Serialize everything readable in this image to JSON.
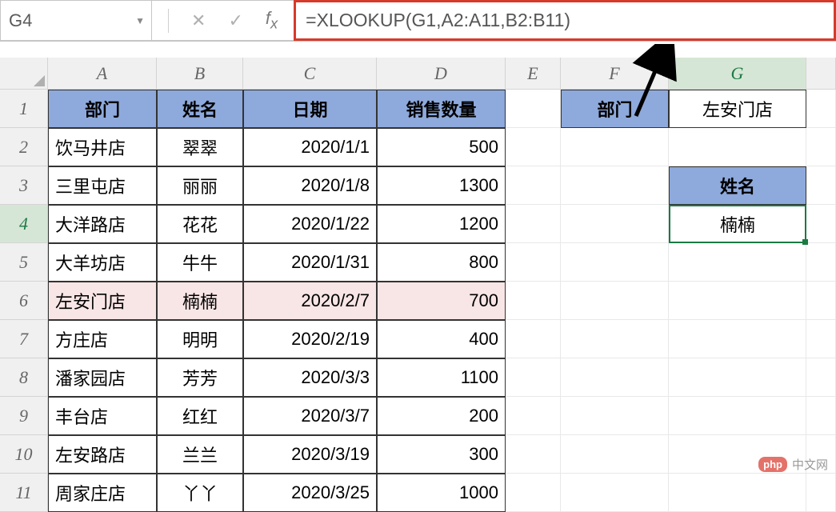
{
  "nameBox": "G4",
  "formula": "=XLOOKUP(G1,A2:A11,B2:B11)",
  "columns": [
    "A",
    "B",
    "C",
    "D",
    "E",
    "F",
    "G"
  ],
  "rows": [
    "1",
    "2",
    "3",
    "4",
    "5",
    "6",
    "7",
    "8",
    "9",
    "10",
    "11"
  ],
  "headers": {
    "A": "部门",
    "B": "姓名",
    "C": "日期",
    "D": "销售数量"
  },
  "lookupHeaders": {
    "F1": "部门",
    "G1": "左安门店",
    "G3": "姓名",
    "G4": "楠楠"
  },
  "tableData": [
    {
      "dept": "饮马井店",
      "name": "翠翠",
      "date": "2020/1/1",
      "sales": "500"
    },
    {
      "dept": "三里屯店",
      "name": "丽丽",
      "date": "2020/1/8",
      "sales": "1300"
    },
    {
      "dept": "大洋路店",
      "name": "花花",
      "date": "2020/1/22",
      "sales": "1200"
    },
    {
      "dept": "大羊坊店",
      "name": "牛牛",
      "date": "2020/1/31",
      "sales": "800"
    },
    {
      "dept": "左安门店",
      "name": "楠楠",
      "date": "2020/2/7",
      "sales": "700"
    },
    {
      "dept": "方庄店",
      "name": "明明",
      "date": "2020/2/19",
      "sales": "400"
    },
    {
      "dept": "潘家园店",
      "name": "芳芳",
      "date": "2020/3/3",
      "sales": "1100"
    },
    {
      "dept": "丰台店",
      "name": "红红",
      "date": "2020/3/7",
      "sales": "200"
    },
    {
      "dept": "左安路店",
      "name": "兰兰",
      "date": "2020/3/19",
      "sales": "300"
    },
    {
      "dept": "周家庄店",
      "name": "丫丫",
      "date": "2020/3/25",
      "sales": "1000"
    }
  ],
  "highlightRowIndex": 4,
  "activeCell": {
    "row": 4,
    "col": "G"
  },
  "watermark": {
    "badge": "php",
    "text": "中文网"
  }
}
